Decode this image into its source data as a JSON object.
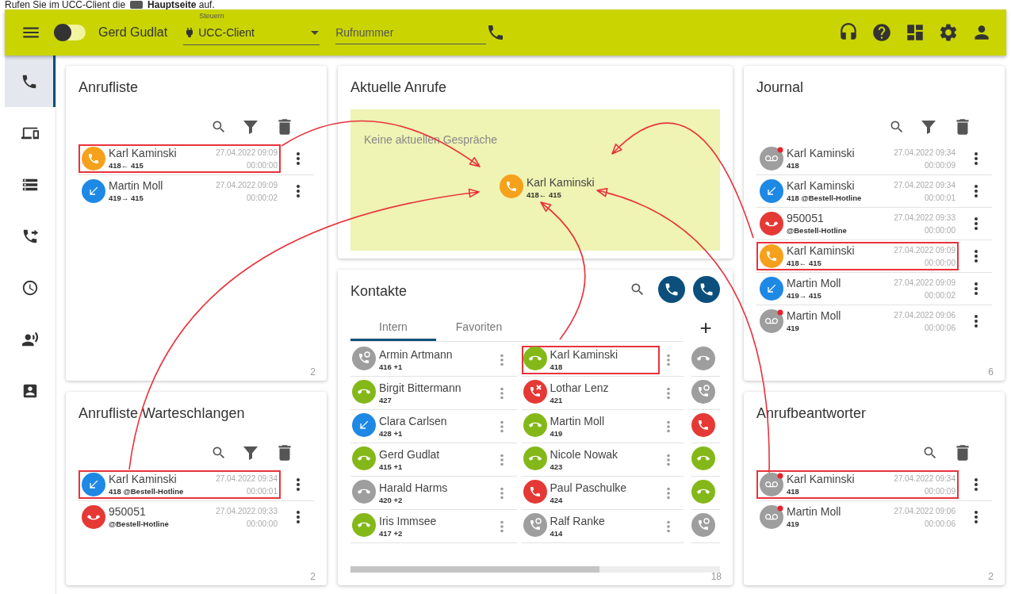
{
  "caption": {
    "start": "Rufen Sie im UCC-Client die",
    "end": "**Hauptseite** auf."
  },
  "topbar": {
    "toggle_on": false,
    "user": "Gerd Gudlat",
    "control_label": "Steuern",
    "control_value": "UCC-Client",
    "phone_placeholder": "Rufnummer"
  },
  "sidebar": {
    "items": [
      {
        "kind": "phone",
        "selected": true
      },
      {
        "kind": "devices",
        "selected": false
      },
      {
        "kind": "servers",
        "selected": false
      },
      {
        "kind": "forward",
        "selected": false
      },
      {
        "kind": "clock",
        "selected": false
      },
      {
        "kind": "voice",
        "selected": false
      },
      {
        "kind": "contact",
        "selected": false
      }
    ]
  },
  "call_list": {
    "title": "Anrufliste",
    "count": "2",
    "rows": [
      {
        "kind": "incoming",
        "name": "Karl Kaminski",
        "detail": "418← 415",
        "date": "27.04.2022 09:09",
        "duration": "00:00:00",
        "highlighted": true
      },
      {
        "kind": "outgoing",
        "name": "Martin Moll",
        "detail": "419→ 415",
        "date": "27.04.2022 09:09",
        "duration": "00:00:02",
        "highlighted": false
      }
    ]
  },
  "queue_list": {
    "title": "Anrufliste Warteschlangen",
    "count": "2",
    "rows": [
      {
        "kind": "outgoing",
        "name": "Karl Kaminski",
        "detail": "418 @Bestell-Hotline",
        "date": "27.04.2022 09:34",
        "duration": "00:00:01",
        "highlighted": true
      },
      {
        "kind": "missed",
        "name": "950051",
        "detail": "@Bestell-Hotline",
        "date": "27.04.2022 09:33",
        "duration": "00:00:00",
        "highlighted": false
      }
    ]
  },
  "current_calls": {
    "title": "Aktuelle Anrufe",
    "empty_text": "Keine aktuellen Gespräche",
    "call": {
      "kind": "incoming",
      "name": "Karl Kaminski",
      "detail": "418← 415"
    }
  },
  "contacts": {
    "title": "Kontakte",
    "tabs": [
      {
        "label": "Intern",
        "selected": true
      },
      {
        "label": "Favoriten",
        "selected": false
      }
    ],
    "add": "+",
    "count": "18",
    "columns": [
      [
        {
          "kind": "away",
          "name": "Armin Artmann",
          "number": "416 +1",
          "highlighted": false
        },
        {
          "kind": "available",
          "name": "Birgit Bittermann",
          "number": "427",
          "highlighted": false
        },
        {
          "kind": "forwarded",
          "name": "Clara Carlsen",
          "number": "428 +1",
          "highlighted": false
        },
        {
          "kind": "available",
          "name": "Gerd Gudlat",
          "number": "415 +1",
          "highlighted": false
        },
        {
          "kind": "offline",
          "name": "Harald Harms",
          "number": "420 +2",
          "highlighted": false
        },
        {
          "kind": "available",
          "name": "Iris Immsee",
          "number": "417 +2",
          "highlighted": false
        }
      ],
      [
        {
          "kind": "available",
          "name": "Karl Kaminski",
          "number": "418",
          "highlighted": true
        },
        {
          "kind": "dnd",
          "name": "Lothar Lenz",
          "number": "421",
          "highlighted": false
        },
        {
          "kind": "available",
          "name": "Martin Moll",
          "number": "419",
          "highlighted": false
        },
        {
          "kind": "available",
          "name": "Nicole Nowak",
          "number": "423",
          "highlighted": false
        },
        {
          "kind": "busy",
          "name": "Paul Paschulke",
          "number": "424",
          "highlighted": false
        },
        {
          "kind": "away",
          "name": "Ralf Ranke",
          "number": "414",
          "highlighted": false
        }
      ]
    ],
    "partial_column": [
      {
        "kind": "offline"
      },
      {
        "kind": "away"
      },
      {
        "kind": "busy"
      },
      {
        "kind": "available"
      },
      {
        "kind": "available"
      },
      {
        "kind": "away"
      }
    ]
  },
  "journal": {
    "title": "Journal",
    "count": "6",
    "rows": [
      {
        "kind": "voicemail",
        "name": "Karl Kaminski",
        "detail": "418",
        "date": "27.04.2022 09:34",
        "duration": "00:00:09",
        "highlighted": false
      },
      {
        "kind": "outgoing",
        "name": "Karl Kaminski",
        "detail": "418 @Bestell-Hotline",
        "date": "27.04.2022 09:34",
        "duration": "00:00:01",
        "highlighted": false
      },
      {
        "kind": "missed",
        "name": "950051",
        "detail": "@Bestell-Hotline",
        "date": "27.04.2022 09:33",
        "duration": "00:00:00",
        "highlighted": false
      },
      {
        "kind": "incoming",
        "name": "Karl Kaminski",
        "detail": "418← 415",
        "date": "27.04.2022 09:09",
        "duration": "00:00:00",
        "highlighted": true
      },
      {
        "kind": "outgoing",
        "name": "Martin Moll",
        "detail": "419→ 415",
        "date": "27.04.2022 09:09",
        "duration": "00:00:02",
        "highlighted": false
      },
      {
        "kind": "voicemail",
        "name": "Martin Moll",
        "detail": "419",
        "date": "27.04.2022 09:06",
        "duration": "00:00:06",
        "highlighted": false
      }
    ]
  },
  "voicemail": {
    "title": "Anrufbeantworter",
    "count": "2",
    "rows": [
      {
        "kind": "voicemail",
        "name": "Karl Kaminski",
        "detail": "418",
        "date": "27.04.2022 09:34",
        "duration": "00:00:09",
        "highlighted": true
      },
      {
        "kind": "voicemail",
        "name": "Martin Moll",
        "detail": "419",
        "date": "27.04.2022 09:06",
        "duration": "00:00:06",
        "highlighted": false
      }
    ]
  }
}
